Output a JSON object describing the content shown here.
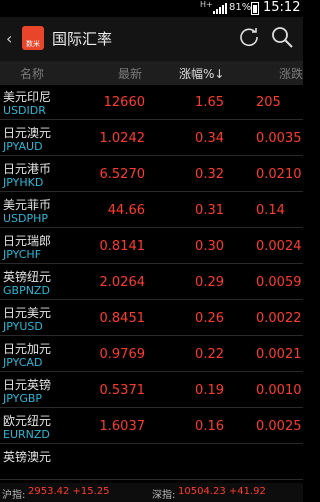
{
  "status_bar": {
    "network": "H+",
    "battery": "81%",
    "time": "15:12"
  },
  "header": {
    "back": "‹",
    "logo_text": "数米",
    "title": "国际汇率",
    "icons": [
      "refresh-icon",
      "search-icon"
    ]
  },
  "columns": {
    "name": "名称",
    "latest": "最新",
    "change_pct": "涨幅%↓",
    "change_amt": "涨跌"
  },
  "rows": [
    {
      "name": "美元印尼",
      "code": "USDIDR",
      "latest": "12660",
      "pct": "1.65",
      "amt": "205"
    },
    {
      "name": "日元澳元",
      "code": "JPYAUD",
      "latest": "1.0242",
      "pct": "0.34",
      "amt": "0.0035"
    },
    {
      "name": "日元港币",
      "code": "JPYHKD",
      "latest": "6.5270",
      "pct": "0.32",
      "amt": "0.0210"
    },
    {
      "name": "美元菲币",
      "code": "USDPHP",
      "latest": "44.66",
      "pct": "0.31",
      "amt": "0.14"
    },
    {
      "name": "日元瑞郎",
      "code": "JPYCHF",
      "latest": "0.8141",
      "pct": "0.30",
      "amt": "0.0024"
    },
    {
      "name": "英镑纽元",
      "code": "GBPNZD",
      "latest": "2.0264",
      "pct": "0.29",
      "amt": "0.0059"
    },
    {
      "name": "日元美元",
      "code": "JPYUSD",
      "latest": "0.8451",
      "pct": "0.26",
      "amt": "0.0022"
    },
    {
      "name": "日元加元",
      "code": "JPYCAD",
      "latest": "0.9769",
      "pct": "0.22",
      "amt": "0.0021"
    },
    {
      "name": "日元英镑",
      "code": "JPYGBP",
      "latest": "0.5371",
      "pct": "0.19",
      "amt": "0.0010"
    },
    {
      "name": "欧元纽元",
      "code": "EURNZD",
      "latest": "1.6037",
      "pct": "0.16",
      "amt": "0.0025"
    },
    {
      "name": "英镑澳元",
      "code": "",
      "latest": "",
      "pct": "",
      "amt": ""
    }
  ],
  "ticker": {
    "sh_label": "沪指:",
    "sh_value": "2953.42 +15.25",
    "sz_label": "深指:",
    "sz_value": "10504.23 +41.92"
  },
  "colors": {
    "up": "#ff3b30",
    "code": "#2bb8d6",
    "logo": "#e8452a"
  }
}
